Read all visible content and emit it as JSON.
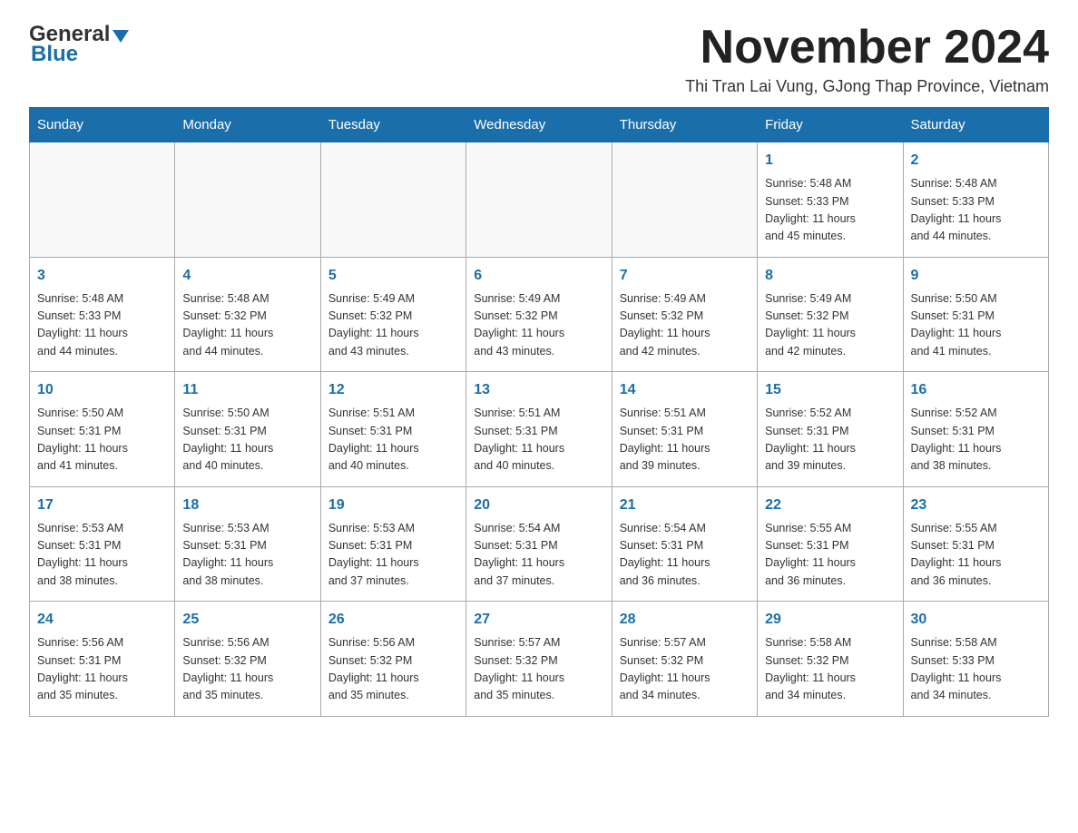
{
  "header": {
    "logo_general": "General",
    "logo_blue": "Blue",
    "month_title": "November 2024",
    "location": "Thi Tran Lai Vung, GJong Thap Province, Vietnam"
  },
  "weekdays": [
    "Sunday",
    "Monday",
    "Tuesday",
    "Wednesday",
    "Thursday",
    "Friday",
    "Saturday"
  ],
  "weeks": [
    [
      {
        "day": "",
        "info": ""
      },
      {
        "day": "",
        "info": ""
      },
      {
        "day": "",
        "info": ""
      },
      {
        "day": "",
        "info": ""
      },
      {
        "day": "",
        "info": ""
      },
      {
        "day": "1",
        "info": "Sunrise: 5:48 AM\nSunset: 5:33 PM\nDaylight: 11 hours\nand 45 minutes."
      },
      {
        "day": "2",
        "info": "Sunrise: 5:48 AM\nSunset: 5:33 PM\nDaylight: 11 hours\nand 44 minutes."
      }
    ],
    [
      {
        "day": "3",
        "info": "Sunrise: 5:48 AM\nSunset: 5:33 PM\nDaylight: 11 hours\nand 44 minutes."
      },
      {
        "day": "4",
        "info": "Sunrise: 5:48 AM\nSunset: 5:32 PM\nDaylight: 11 hours\nand 44 minutes."
      },
      {
        "day": "5",
        "info": "Sunrise: 5:49 AM\nSunset: 5:32 PM\nDaylight: 11 hours\nand 43 minutes."
      },
      {
        "day": "6",
        "info": "Sunrise: 5:49 AM\nSunset: 5:32 PM\nDaylight: 11 hours\nand 43 minutes."
      },
      {
        "day": "7",
        "info": "Sunrise: 5:49 AM\nSunset: 5:32 PM\nDaylight: 11 hours\nand 42 minutes."
      },
      {
        "day": "8",
        "info": "Sunrise: 5:49 AM\nSunset: 5:32 PM\nDaylight: 11 hours\nand 42 minutes."
      },
      {
        "day": "9",
        "info": "Sunrise: 5:50 AM\nSunset: 5:31 PM\nDaylight: 11 hours\nand 41 minutes."
      }
    ],
    [
      {
        "day": "10",
        "info": "Sunrise: 5:50 AM\nSunset: 5:31 PM\nDaylight: 11 hours\nand 41 minutes."
      },
      {
        "day": "11",
        "info": "Sunrise: 5:50 AM\nSunset: 5:31 PM\nDaylight: 11 hours\nand 40 minutes."
      },
      {
        "day": "12",
        "info": "Sunrise: 5:51 AM\nSunset: 5:31 PM\nDaylight: 11 hours\nand 40 minutes."
      },
      {
        "day": "13",
        "info": "Sunrise: 5:51 AM\nSunset: 5:31 PM\nDaylight: 11 hours\nand 40 minutes."
      },
      {
        "day": "14",
        "info": "Sunrise: 5:51 AM\nSunset: 5:31 PM\nDaylight: 11 hours\nand 39 minutes."
      },
      {
        "day": "15",
        "info": "Sunrise: 5:52 AM\nSunset: 5:31 PM\nDaylight: 11 hours\nand 39 minutes."
      },
      {
        "day": "16",
        "info": "Sunrise: 5:52 AM\nSunset: 5:31 PM\nDaylight: 11 hours\nand 38 minutes."
      }
    ],
    [
      {
        "day": "17",
        "info": "Sunrise: 5:53 AM\nSunset: 5:31 PM\nDaylight: 11 hours\nand 38 minutes."
      },
      {
        "day": "18",
        "info": "Sunrise: 5:53 AM\nSunset: 5:31 PM\nDaylight: 11 hours\nand 38 minutes."
      },
      {
        "day": "19",
        "info": "Sunrise: 5:53 AM\nSunset: 5:31 PM\nDaylight: 11 hours\nand 37 minutes."
      },
      {
        "day": "20",
        "info": "Sunrise: 5:54 AM\nSunset: 5:31 PM\nDaylight: 11 hours\nand 37 minutes."
      },
      {
        "day": "21",
        "info": "Sunrise: 5:54 AM\nSunset: 5:31 PM\nDaylight: 11 hours\nand 36 minutes."
      },
      {
        "day": "22",
        "info": "Sunrise: 5:55 AM\nSunset: 5:31 PM\nDaylight: 11 hours\nand 36 minutes."
      },
      {
        "day": "23",
        "info": "Sunrise: 5:55 AM\nSunset: 5:31 PM\nDaylight: 11 hours\nand 36 minutes."
      }
    ],
    [
      {
        "day": "24",
        "info": "Sunrise: 5:56 AM\nSunset: 5:31 PM\nDaylight: 11 hours\nand 35 minutes."
      },
      {
        "day": "25",
        "info": "Sunrise: 5:56 AM\nSunset: 5:32 PM\nDaylight: 11 hours\nand 35 minutes."
      },
      {
        "day": "26",
        "info": "Sunrise: 5:56 AM\nSunset: 5:32 PM\nDaylight: 11 hours\nand 35 minutes."
      },
      {
        "day": "27",
        "info": "Sunrise: 5:57 AM\nSunset: 5:32 PM\nDaylight: 11 hours\nand 35 minutes."
      },
      {
        "day": "28",
        "info": "Sunrise: 5:57 AM\nSunset: 5:32 PM\nDaylight: 11 hours\nand 34 minutes."
      },
      {
        "day": "29",
        "info": "Sunrise: 5:58 AM\nSunset: 5:32 PM\nDaylight: 11 hours\nand 34 minutes."
      },
      {
        "day": "30",
        "info": "Sunrise: 5:58 AM\nSunset: 5:33 PM\nDaylight: 11 hours\nand 34 minutes."
      }
    ]
  ]
}
